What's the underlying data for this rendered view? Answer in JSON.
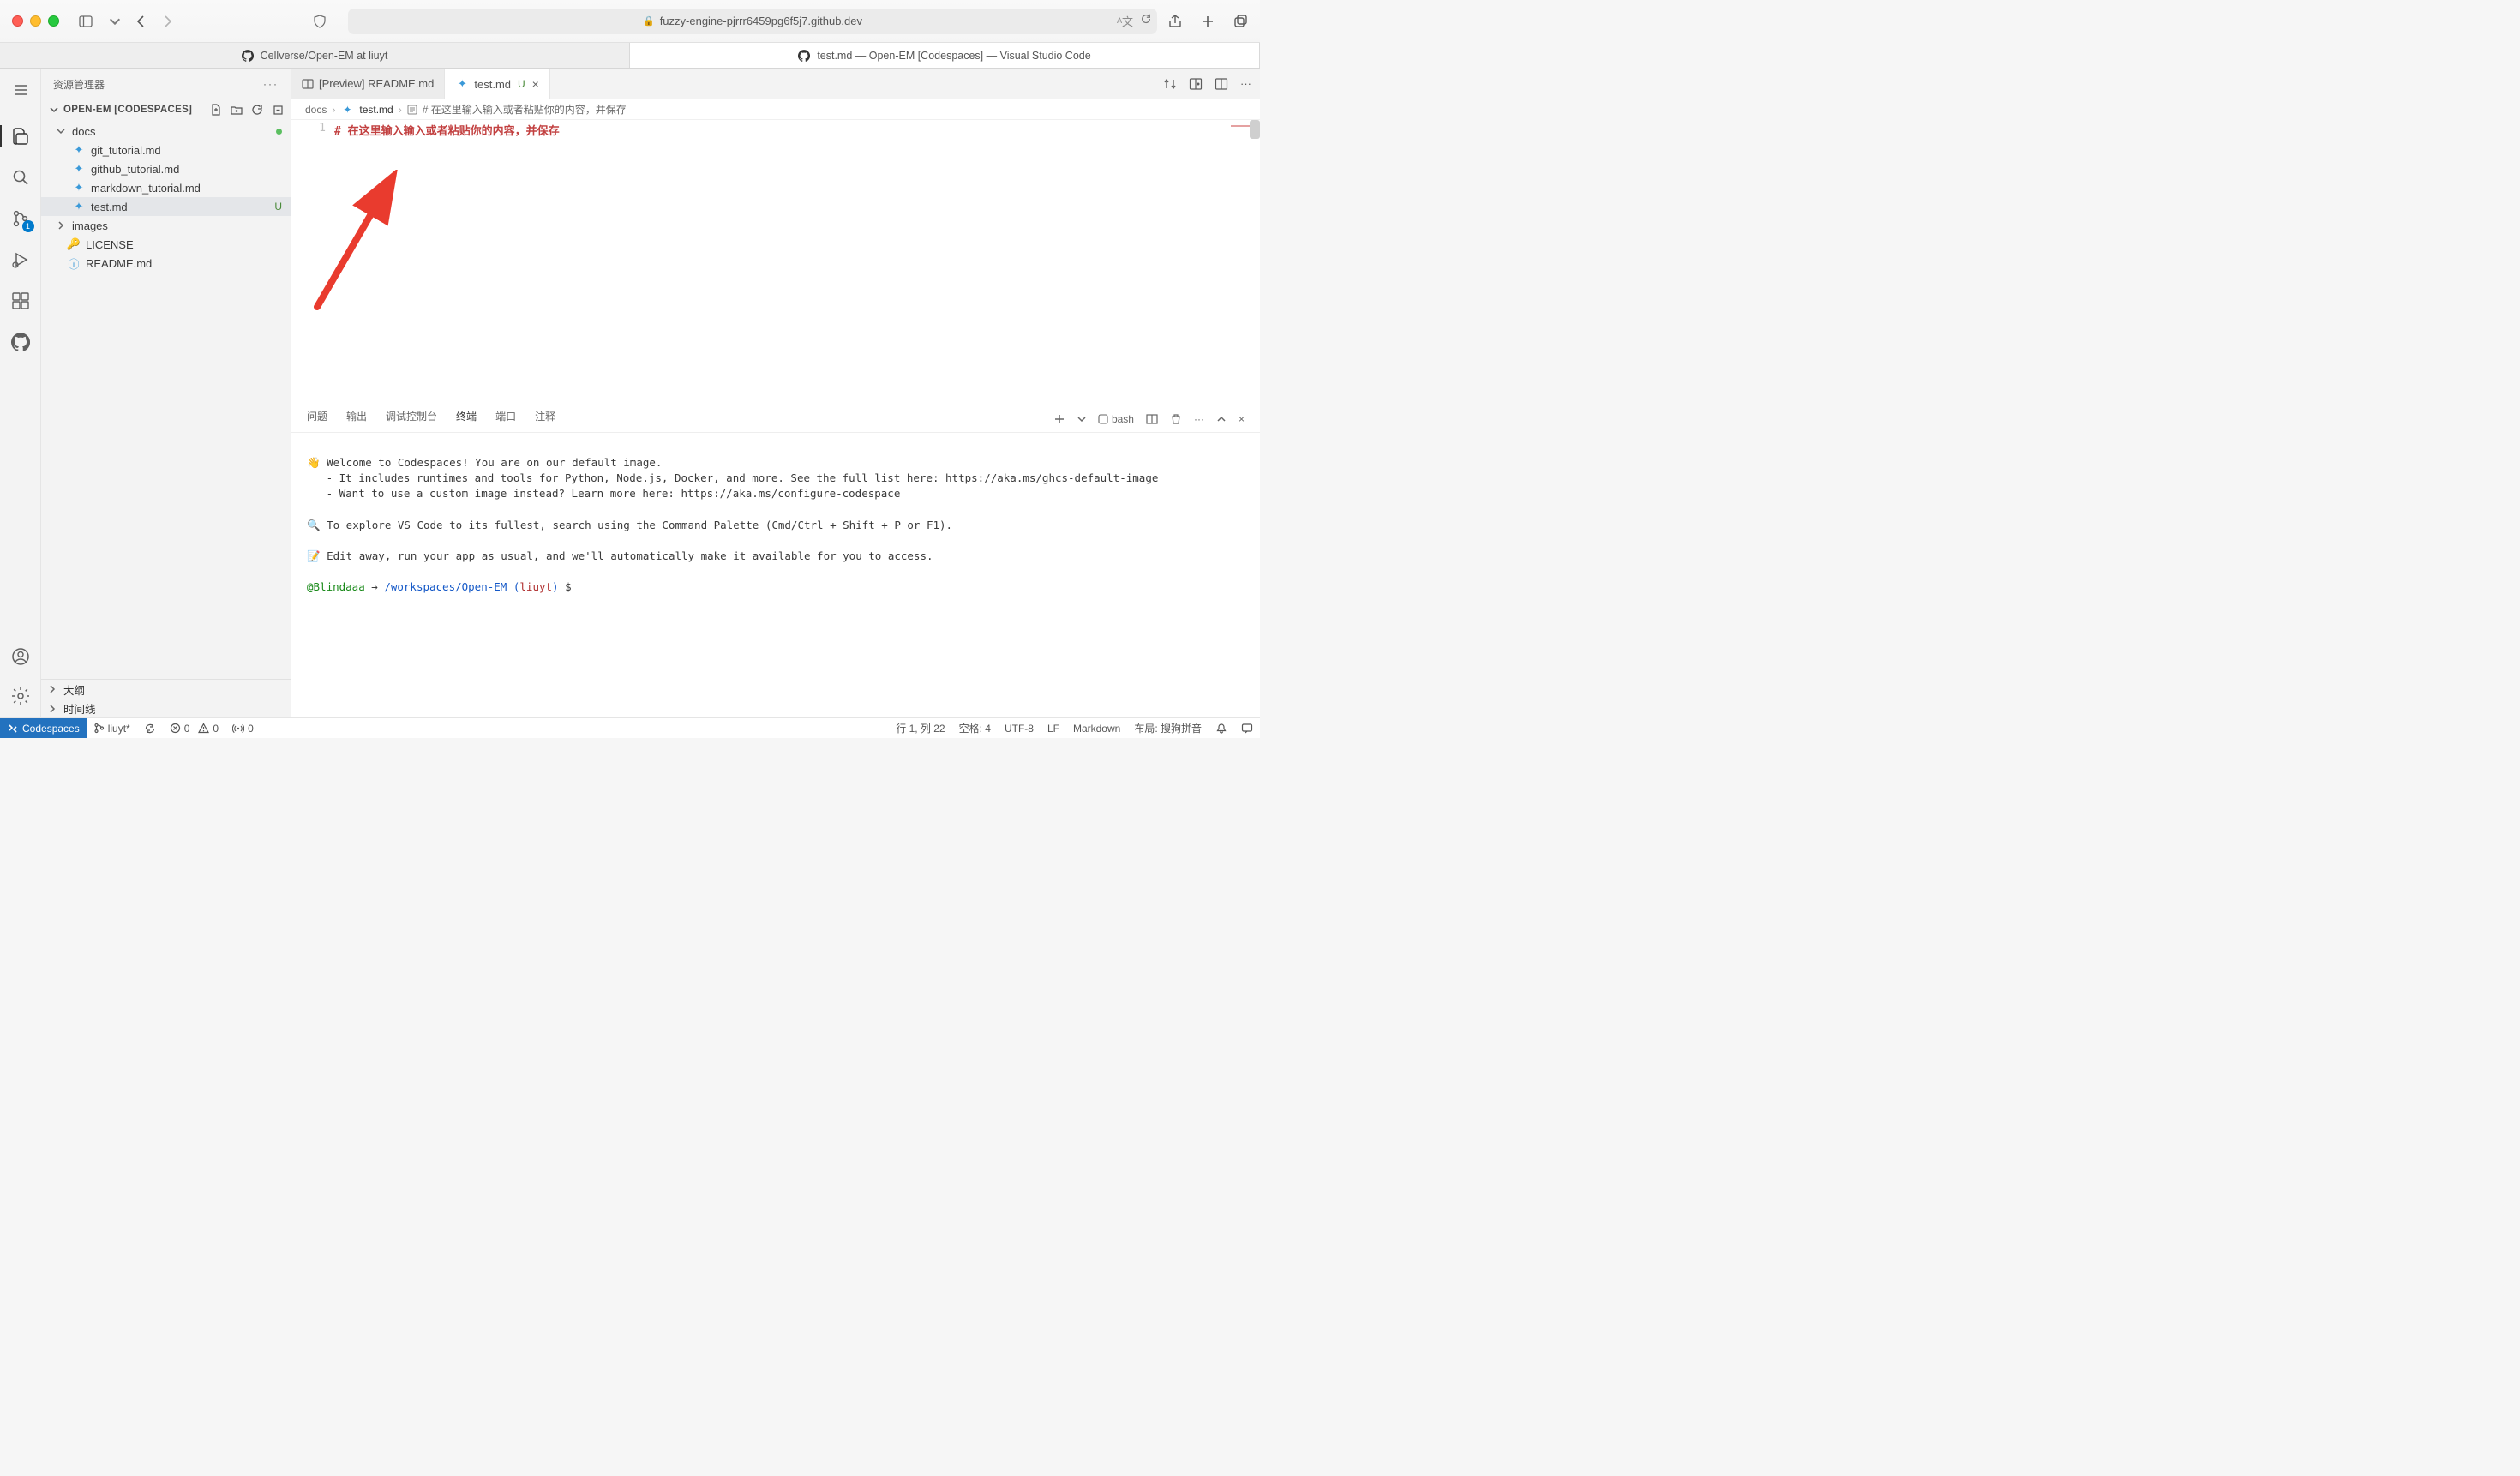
{
  "browser": {
    "url": "fuzzy-engine-pjrrr6459pg6f5j7.github.dev",
    "tabs": [
      {
        "title": "Cellverse/Open-EM at liuyt"
      },
      {
        "title": "test.md — Open-EM [Codespaces] — Visual Studio Code"
      }
    ]
  },
  "sidebar": {
    "title": "资源管理器",
    "section": "OPEN-EM [CODESPACES]",
    "tree": {
      "docs": {
        "label": "docs",
        "items": [
          {
            "label": "git_tutorial.md"
          },
          {
            "label": "github_tutorial.md"
          },
          {
            "label": "markdown_tutorial.md"
          },
          {
            "label": "test.md",
            "status": "U"
          }
        ]
      },
      "images": {
        "label": "images"
      },
      "license": {
        "label": "LICENSE"
      },
      "readme": {
        "label": "README.md"
      }
    },
    "outline": "大纲",
    "timeline": "时间线"
  },
  "editor": {
    "tabs": [
      {
        "label": "[Preview] README.md"
      },
      {
        "label": "test.md",
        "status": "U"
      }
    ],
    "breadcrumb": {
      "p0": "docs",
      "p1": "test.md",
      "p2": "# 在这里输入输入或者粘贴你的内容，并保存"
    },
    "line_number": "1",
    "line_content": "# 在这里输入输入或者粘贴你的内容，并保存"
  },
  "panel": {
    "tabs": {
      "problems": "问题",
      "output": "输出",
      "debug": "调试控制台",
      "terminal": "终端",
      "ports": "端口",
      "comments": "注释"
    },
    "shell_label": "bash",
    "terminal_lines": {
      "l1": "👋 Welcome to Codespaces! You are on our default image.",
      "l2": "   - It includes runtimes and tools for Python, Node.js, Docker, and more. See the full list here: https://aka.ms/ghcs-default-image",
      "l3": "   - Want to use a custom image instead? Learn more here: https://aka.ms/configure-codespace",
      "l4": "🔍 To explore VS Code to its fullest, search using the Command Palette (Cmd/Ctrl + Shift + P or F1).",
      "l5": "📝 Edit away, run your app as usual, and we'll automatically make it available for you to access."
    },
    "prompt": {
      "user": "@Blindaaa",
      "arrow": "→",
      "path": "/workspaces/Open-EM",
      "branch": "liuyt",
      "dollar": "$"
    }
  },
  "status": {
    "codespaces": "Codespaces",
    "branch": "liuyt*",
    "sync": "",
    "errors": "0",
    "warnings": "0",
    "ports": "0",
    "cursor": "行 1, 列 22",
    "spaces": "空格: 4",
    "encoding": "UTF-8",
    "eol": "LF",
    "lang": "Markdown",
    "layout": "布局: 搜狗拼音"
  },
  "scm_badge": "1"
}
